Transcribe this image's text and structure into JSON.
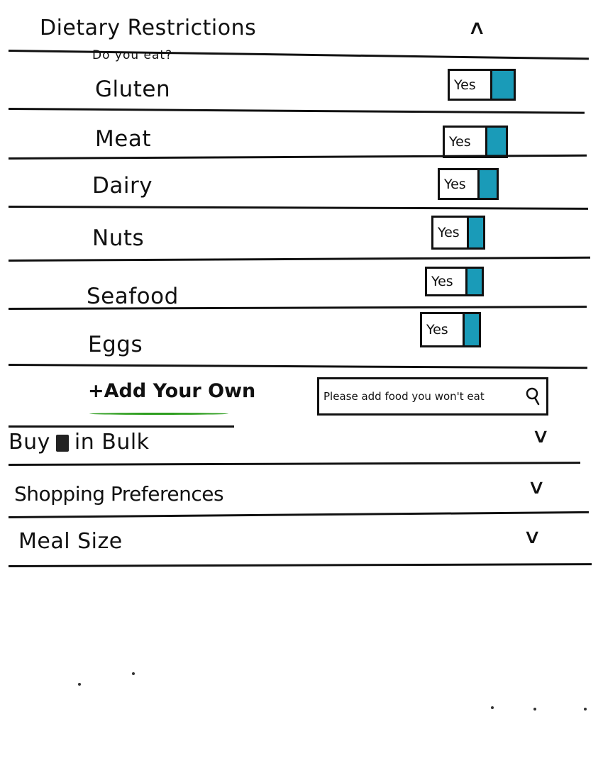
{
  "dietary": {
    "title": "Dietary Restrictions",
    "subtitle": "Do you eat?",
    "collapse_icon": "chevron-up-icon",
    "items": [
      {
        "label": "Gluten",
        "toggle_label": "Yes"
      },
      {
        "label": "Meat",
        "toggle_label": "Yes"
      },
      {
        "label": "Dairy",
        "toggle_label": "Yes"
      },
      {
        "label": "Nuts",
        "toggle_label": "Yes"
      },
      {
        "label": "Seafood",
        "toggle_label": "Yes"
      },
      {
        "label": "Eggs",
        "toggle_label": "Yes"
      }
    ],
    "add_own_label": "+Add Your Own",
    "search_placeholder": "Please add food you won't eat",
    "search_icon": "search-icon"
  },
  "sections": [
    {
      "title_before": "Buy",
      "title_after": "in Bulk",
      "expand_icon": "chevron-down-icon"
    },
    {
      "title": "Shopping Preferences",
      "expand_icon": "chevron-down-icon"
    },
    {
      "title": "Meal Size",
      "expand_icon": "chevron-down-icon"
    }
  ],
  "colors": {
    "toggle_on": "#1a9bb8",
    "add_underline": "#2e9e1f",
    "ink": "#111111"
  }
}
